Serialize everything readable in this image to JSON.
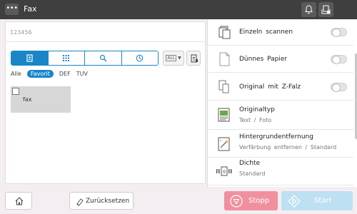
{
  "header": {
    "title": "Fax",
    "menu_icon": "more-icon",
    "notification_icon": "bell-icon",
    "status_icon": "device-status-icon"
  },
  "destination": {
    "number_value": "123456",
    "search_tabs": [
      {
        "name": "address-book-icon",
        "active": true
      },
      {
        "name": "keypad-icon",
        "active": false
      },
      {
        "name": "search-icon",
        "active": false
      },
      {
        "name": "history-icon",
        "active": false
      }
    ],
    "index_dropdown": "ALL",
    "filters": [
      "Alle",
      "Favorit",
      "DEF",
      "TUV"
    ],
    "active_filter": "Favorit",
    "items": [
      {
        "label": "fax",
        "checked": false
      }
    ]
  },
  "settings": [
    {
      "title": "Einzeln scannen",
      "toggle": false
    },
    {
      "title": "Dünnes Papier",
      "toggle": false
    },
    {
      "title": "Original mit Z-Falz",
      "toggle": false
    },
    {
      "title": "Originaltyp",
      "subtitle": "Text / Foto"
    },
    {
      "title": "Hintergrundentfernung",
      "subtitle": "Verfärbung entfernen / Standard"
    },
    {
      "title": "Dichte",
      "subtitle": "Standard"
    }
  ],
  "footer": {
    "reset_label": "Zurücksetzen",
    "stop_label": "Stopp",
    "start_label": "Start"
  },
  "colors": {
    "accent": "#1a86c8",
    "stop": "#f0909e",
    "start": "#bde0f2",
    "topbar": "#3f3f3f"
  }
}
